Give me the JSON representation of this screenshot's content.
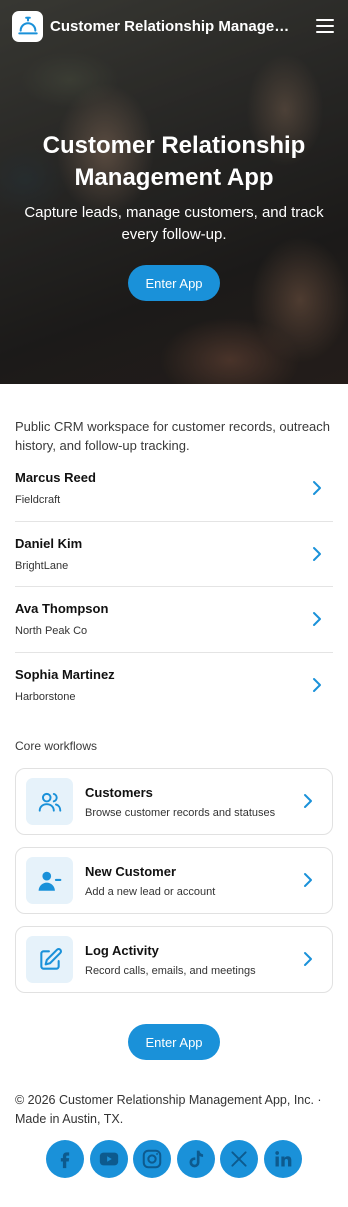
{
  "header": {
    "app_title": "Customer Relationship Management App",
    "menu_icon": "hamburger-menu-icon",
    "logo_icon": "service-bell-icon"
  },
  "hero": {
    "title": "Customer Relationship Management App",
    "subtitle": "Capture leads, manage customers, and track every follow-up.",
    "cta_label": "Enter App"
  },
  "intro": "Public CRM workspace for customer records, outreach history, and follow-up tracking.",
  "contacts": [
    {
      "name": "Marcus Reed",
      "company": "Fieldcraft"
    },
    {
      "name": "Daniel Kim",
      "company": "BrightLane"
    },
    {
      "name": "Ava Thompson",
      "company": "North Peak Co"
    },
    {
      "name": "Sophia Martinez",
      "company": "Harborstone"
    }
  ],
  "workflows": {
    "section_label": "Core workflows",
    "items": [
      {
        "title": "Customers",
        "description": "Browse customer records and statuses",
        "icon": "users-icon"
      },
      {
        "title": "New Customer",
        "description": "Add a new lead or account",
        "icon": "user-minus-icon"
      },
      {
        "title": "Log Activity",
        "description": "Record calls, emails, and meetings",
        "icon": "edit-icon"
      }
    ]
  },
  "bottom_cta_label": "Enter App",
  "footer": {
    "text": "© 2026 Customer Relationship Management App, Inc. · Made in Austin, TX.",
    "socials": [
      "facebook-icon",
      "youtube-icon",
      "instagram-icon",
      "tiktok-icon",
      "x-icon",
      "linkedin-icon"
    ]
  },
  "colors": {
    "accent": "#1a91d9",
    "icon_bg": "#e6f2fa"
  }
}
